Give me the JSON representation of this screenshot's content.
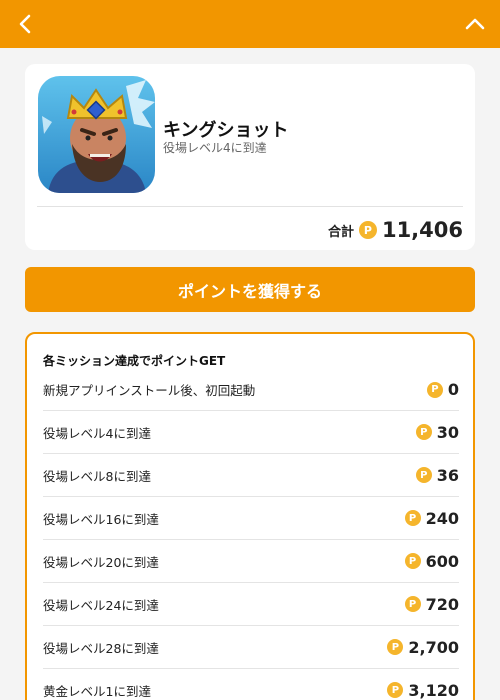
{
  "header": {
    "back_icon": "chevron-left-icon",
    "collapse_icon": "chevron-up-icon"
  },
  "app": {
    "name": "キングショット",
    "subtitle": "役場レベル4に到達",
    "total_label": "合計",
    "total_value": "11,406",
    "coin_symbol": "P"
  },
  "get_button": {
    "label": "ポイントを獲得する"
  },
  "missions": {
    "header": "各ミッション達成でポイントGET",
    "items": [
      {
        "label": "新規アプリインストール後、初回起動",
        "points": "0"
      },
      {
        "label": "役場レベル4に到達",
        "points": "30"
      },
      {
        "label": "役場レベル8に到達",
        "points": "36"
      },
      {
        "label": "役場レベル16に到達",
        "points": "240"
      },
      {
        "label": "役場レベル20に到達",
        "points": "600"
      },
      {
        "label": "役場レベル24に到達",
        "points": "720"
      },
      {
        "label": "役場レベル28に到達",
        "points": "2,700"
      },
      {
        "label": "黄金レベル1に到達",
        "points": "3,120"
      }
    ]
  },
  "colors": {
    "accent": "#f29600",
    "coin": "#f5b52c",
    "background": "#f4f4f4"
  }
}
